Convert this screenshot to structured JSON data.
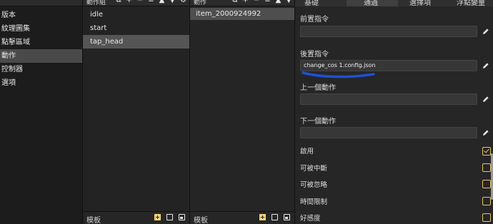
{
  "nav": {
    "items": [
      "版本",
      "紋理圖集",
      "點擊區域",
      "動作",
      "控制器",
      "選項"
    ],
    "active": "動作"
  },
  "groups": {
    "header_title": "動作組",
    "items": [
      "idle",
      "start",
      "tap_head"
    ],
    "active": "tap_head",
    "footer_title": "模板"
  },
  "actions": {
    "header_title": "動作",
    "items": [
      "item_2000924992"
    ],
    "footer_title": "模板"
  },
  "props": {
    "tabs": [
      "基礎",
      "通過",
      "選擇項",
      "浮點變量"
    ],
    "active_tab": "通過",
    "fields": [
      {
        "label": "前置指令",
        "value": ""
      },
      {
        "label": "後置指令",
        "value": "change_cos 1.config.json"
      },
      {
        "label": "上一個動作",
        "value": ""
      },
      {
        "label": "下一個動作",
        "value": ""
      }
    ],
    "checkboxes": [
      {
        "label": "啟用",
        "checked": true
      },
      {
        "label": "可被中斷",
        "checked": false
      },
      {
        "label": "可被忽略",
        "checked": false
      },
      {
        "label": "時間限制",
        "checked": false
      },
      {
        "label": "好感度",
        "checked": false
      }
    ]
  },
  "colors": {
    "accent": "#e9c46a",
    "annotation": "#1f4fd6"
  }
}
